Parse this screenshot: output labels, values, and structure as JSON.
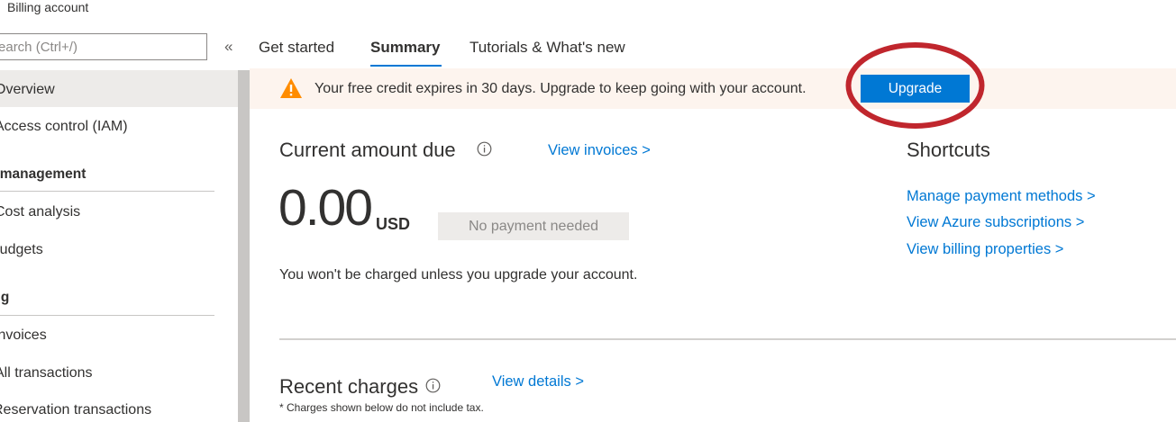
{
  "page": {
    "title": "Billing account"
  },
  "sidebar": {
    "search_placeholder": "Search (Ctrl+/)",
    "collapse_glyph": "«",
    "items": [
      {
        "label": "Overview"
      },
      {
        "label": "Access control (IAM)"
      }
    ],
    "cost_group": {
      "heading": "Cost management",
      "items": [
        {
          "label": "Cost analysis"
        },
        {
          "label": "Budgets"
        }
      ]
    },
    "billing_group": {
      "heading": "Billing",
      "items": [
        {
          "label": "Invoices"
        },
        {
          "label": "All transactions"
        },
        {
          "label": "Reservation transactions"
        }
      ]
    }
  },
  "tabs": [
    {
      "label": "Get started"
    },
    {
      "label": "Summary",
      "selected": true
    },
    {
      "label": "Tutorials & What's new"
    }
  ],
  "banner": {
    "text": "Your free credit expires in 30 days. Upgrade to keep going with your account.",
    "button_label": "Upgrade",
    "icon": "warning-icon",
    "highlight_color": "#c0262d"
  },
  "current_due": {
    "heading": "Current amount due",
    "link": "View invoices >",
    "amount": "0.00",
    "currency": "USD",
    "status_badge": "No payment needed",
    "note": "You won't be charged unless you upgrade your account."
  },
  "shortcuts": {
    "heading": "Shortcuts",
    "links": [
      {
        "label": "Manage payment methods >"
      },
      {
        "label": "View Azure subscriptions >"
      },
      {
        "label": "View billing properties >"
      }
    ]
  },
  "recent_charges": {
    "heading": "Recent charges",
    "link": "View details >",
    "footnote": "* Charges shown below do not include tax."
  },
  "colors": {
    "accent": "#0078d4",
    "warning": "#ff8c00",
    "banner_bg": "#fdf4ee"
  }
}
